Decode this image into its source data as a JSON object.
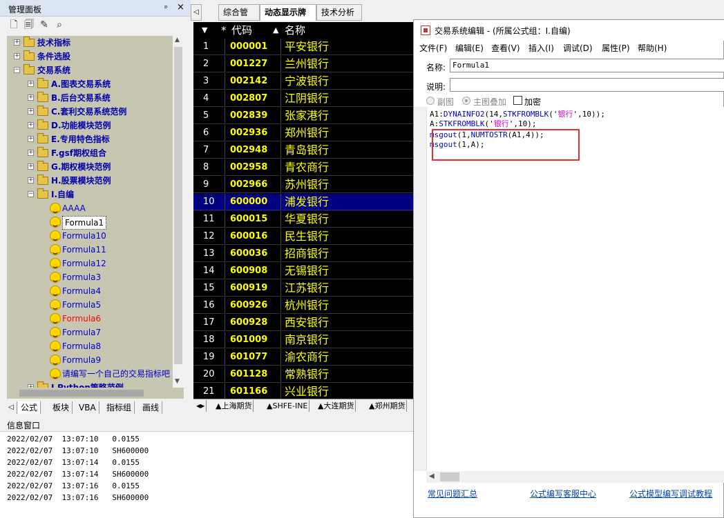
{
  "left_panel": {
    "title": "管理面板",
    "pin": "ᵖ",
    "close": "×",
    "toolbar_icons": [
      "new-formula-icon",
      "new-folder-icon",
      "edit-icon",
      "search-icon"
    ],
    "tree": [
      {
        "label": "技术指标",
        "level": 0,
        "kind": "folder",
        "exp": "+"
      },
      {
        "label": "条件选股",
        "level": 0,
        "kind": "folder",
        "exp": "+"
      },
      {
        "label": "交易系统",
        "level": 0,
        "kind": "folder",
        "exp": "−"
      },
      {
        "label": "A.图表交易系统",
        "level": 1,
        "kind": "folder",
        "exp": "+"
      },
      {
        "label": "B.后台交易系统",
        "level": 1,
        "kind": "folder",
        "exp": "+"
      },
      {
        "label": "C.套利交易系统范例",
        "level": 1,
        "kind": "folder",
        "exp": "+"
      },
      {
        "label": "D.功能模块范例",
        "level": 1,
        "kind": "folder",
        "exp": "+"
      },
      {
        "label": "E.专用特色指标",
        "level": 1,
        "kind": "folder",
        "exp": "+"
      },
      {
        "label": "F.gsf期权组合",
        "level": 1,
        "kind": "folder",
        "exp": "+"
      },
      {
        "label": "G.期权模块范例",
        "level": 1,
        "kind": "folder",
        "exp": "+"
      },
      {
        "label": "H.股票模块范例",
        "level": 1,
        "kind": "folder",
        "exp": "+"
      },
      {
        "label": "I.自编",
        "level": 1,
        "kind": "folder",
        "exp": "−"
      },
      {
        "label": "AAAA",
        "level": 2,
        "kind": "formula",
        "color": "#0000cc"
      },
      {
        "label": "Formula1",
        "level": 2,
        "kind": "formula",
        "color": "#000000",
        "selected": true
      },
      {
        "label": "Formula10",
        "level": 2,
        "kind": "formula",
        "color": "#0000cc"
      },
      {
        "label": "Formula11",
        "level": 2,
        "kind": "formula",
        "color": "#0000cc"
      },
      {
        "label": "Formula12",
        "level": 2,
        "kind": "formula",
        "color": "#0000cc"
      },
      {
        "label": "Formula3",
        "level": 2,
        "kind": "formula",
        "color": "#0000cc"
      },
      {
        "label": "Formula4",
        "level": 2,
        "kind": "formula",
        "color": "#0000cc"
      },
      {
        "label": "Formula5",
        "level": 2,
        "kind": "formula",
        "color": "#0000cc"
      },
      {
        "label": "Formula6",
        "level": 2,
        "kind": "formula",
        "color": "#ff0000"
      },
      {
        "label": "Formula7",
        "level": 2,
        "kind": "formula",
        "color": "#0000cc"
      },
      {
        "label": "Formula8",
        "level": 2,
        "kind": "formula",
        "color": "#0000cc"
      },
      {
        "label": "Formula9",
        "level": 2,
        "kind": "formula",
        "color": "#0000cc"
      },
      {
        "label": "请编写一个自己的交易指标吧",
        "level": 2,
        "kind": "formula",
        "color": "#0000cc"
      },
      {
        "label": "J.Python策略范例",
        "level": 1,
        "kind": "folder",
        "exp": "+"
      }
    ],
    "bottom_tabs": [
      "公式",
      "板块",
      "VBA",
      "指标组",
      "画线"
    ]
  },
  "center": {
    "tabs": [
      "综合管理",
      "动态显示牌",
      "技术分析"
    ],
    "active_tab": 1,
    "columns": {
      "star": "*",
      "code": "代码",
      "sort": "▲",
      "name": "名称"
    },
    "rows": [
      {
        "n": "1",
        "code": "000001",
        "name": "平安银行"
      },
      {
        "n": "2",
        "code": "001227",
        "name": "兰州银行"
      },
      {
        "n": "3",
        "code": "002142",
        "name": "宁波银行"
      },
      {
        "n": "4",
        "code": "002807",
        "name": "江阴银行"
      },
      {
        "n": "5",
        "code": "002839",
        "name": "张家港行"
      },
      {
        "n": "6",
        "code": "002936",
        "name": "郑州银行"
      },
      {
        "n": "7",
        "code": "002948",
        "name": "青岛银行"
      },
      {
        "n": "8",
        "code": "002958",
        "name": "青农商行"
      },
      {
        "n": "9",
        "code": "002966",
        "name": "苏州银行"
      },
      {
        "n": "10",
        "code": "600000",
        "name": "浦发银行",
        "selected": true
      },
      {
        "n": "11",
        "code": "600015",
        "name": "华夏银行"
      },
      {
        "n": "12",
        "code": "600016",
        "name": "民生银行"
      },
      {
        "n": "13",
        "code": "600036",
        "name": "招商银行"
      },
      {
        "n": "14",
        "code": "600908",
        "name": "无锡银行"
      },
      {
        "n": "15",
        "code": "600919",
        "name": "江苏银行"
      },
      {
        "n": "16",
        "code": "600926",
        "name": "杭州银行"
      },
      {
        "n": "17",
        "code": "600928",
        "name": "西安银行"
      },
      {
        "n": "18",
        "code": "601009",
        "name": "南京银行"
      },
      {
        "n": "19",
        "code": "601077",
        "name": "渝农商行"
      },
      {
        "n": "20",
        "code": "601128",
        "name": "常熟银行"
      },
      {
        "n": "21",
        "code": "601166",
        "name": "兴业银行"
      }
    ],
    "bottom_tabs": [
      "▲上海期货",
      "▲SHFE-INE",
      "▲大连期货",
      "▲郑州期货"
    ]
  },
  "info": {
    "title": "信息窗口",
    "lines": [
      "2022/02/07  13:07:10   0.0155",
      "2022/02/07  13:07:10   SH600000",
      "2022/02/07  13:07:14   0.0155",
      "2022/02/07  13:07:14   SH600000",
      "2022/02/07  13:07:16   0.0155",
      "2022/02/07  13:07:16   SH600000"
    ]
  },
  "dialog": {
    "title": "交易系统编辑 - (所属公式组：I.自编)",
    "menu": [
      "文件(F)",
      "编辑(E)",
      "查看(V)",
      "插入(I)",
      "调试(D)",
      "属性(P)",
      "帮助(H)"
    ],
    "name_label": "名称:",
    "name_value": "Formula1",
    "desc_label": "说明:",
    "desc_value": "",
    "radio_sub": "副图",
    "radio_main": "主图叠加",
    "encrypt": "加密",
    "code_lines": [
      [
        {
          "t": "A1:",
          "c": "b"
        },
        {
          "t": "DYNAINFO2",
          "c": "k"
        },
        {
          "t": "(14,",
          "c": "b"
        },
        {
          "t": "STKFROMBLK",
          "c": "k"
        },
        {
          "t": "('",
          "c": "b"
        },
        {
          "t": "银行",
          "c": "s"
        },
        {
          "t": "',10));",
          "c": "b"
        }
      ],
      [
        {
          "t": "A:",
          "c": "b"
        },
        {
          "t": "STKFROMBLK",
          "c": "k"
        },
        {
          "t": "('",
          "c": "b"
        },
        {
          "t": "银行",
          "c": "s"
        },
        {
          "t": "',10);",
          "c": "b"
        }
      ],
      [
        {
          "t": "msgout",
          "c": "k"
        },
        {
          "t": "(1,",
          "c": "b"
        },
        {
          "t": "NUMTOSTR",
          "c": "k"
        },
        {
          "t": "(A1,4));",
          "c": "b"
        }
      ],
      [
        {
          "t": "msgout",
          "c": "k"
        },
        {
          "t": "(1,A);",
          "c": "b"
        }
      ]
    ],
    "footer_links": [
      "常见问题汇总",
      "公式编写客服中心",
      "公式模型编写调试教程"
    ]
  }
}
